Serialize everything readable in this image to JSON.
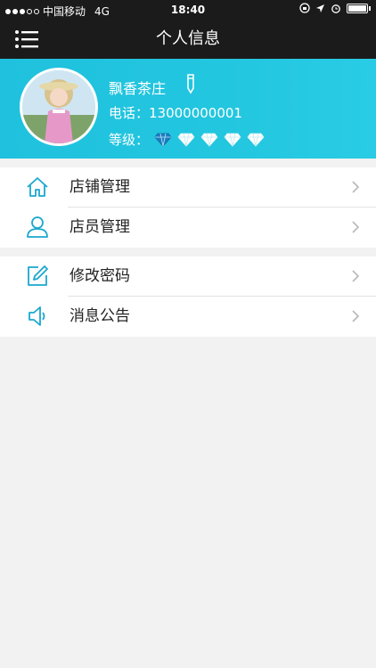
{
  "status_bar": {
    "carrier": "中国移动",
    "network": "4G",
    "time": "18:40"
  },
  "nav": {
    "title": "个人信息"
  },
  "profile": {
    "name": "飘香茶庄",
    "phone_text": "电话：13000000001",
    "level_label": "等级：",
    "level_max": 5,
    "level_value": 1
  },
  "menu": {
    "store_management": "店铺管理",
    "staff_management": "店员管理",
    "change_password": "修改密码",
    "announcements": "消息公告"
  },
  "colors": {
    "accent": "#20c3df",
    "icon": "#1aa8cf",
    "bar": "#1b1b1b"
  }
}
